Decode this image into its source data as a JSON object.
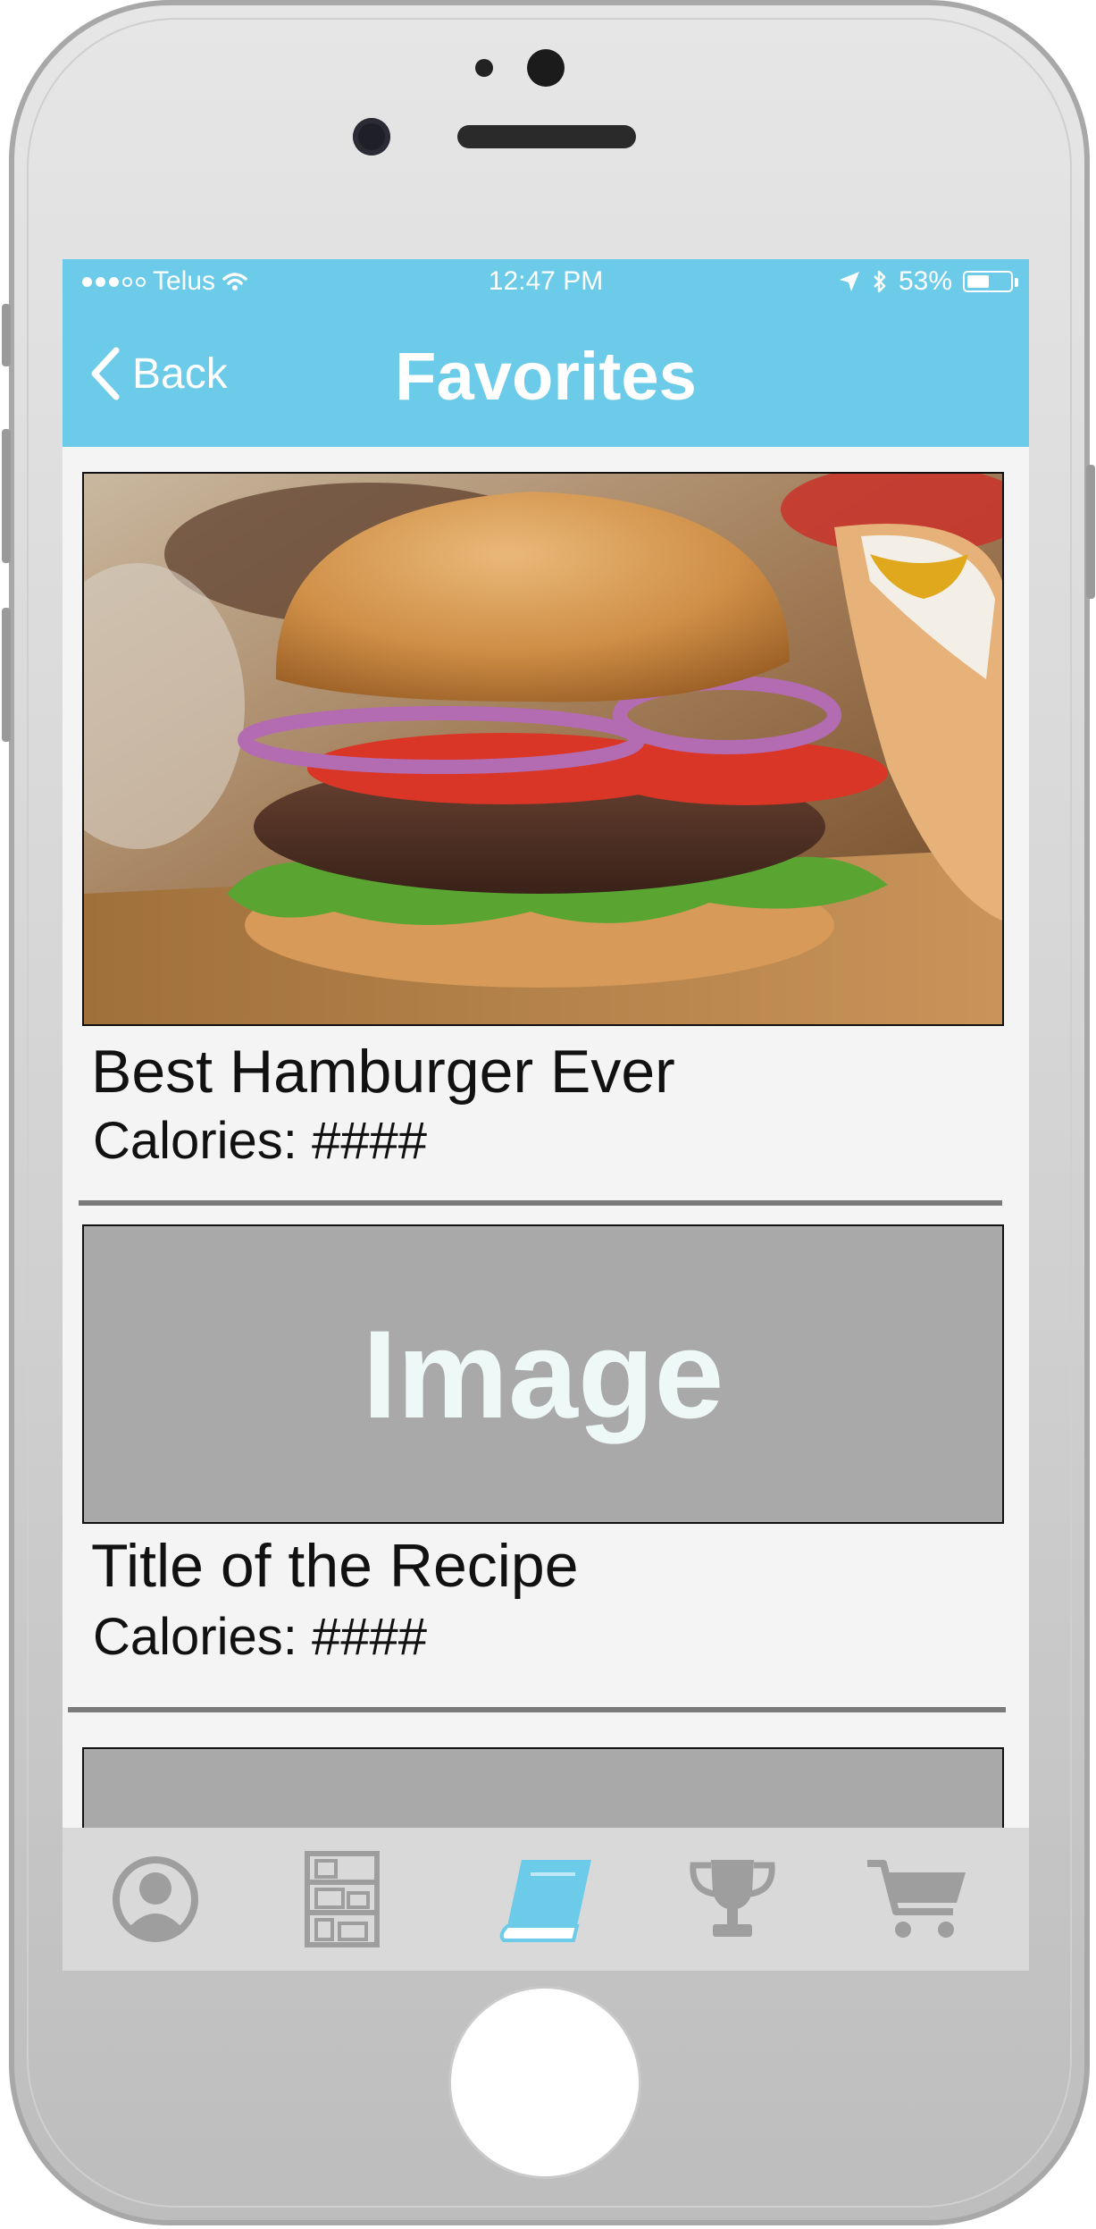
{
  "status_bar": {
    "carrier": "Telus",
    "time": "12:47 PM",
    "battery": "53%",
    "battery_level": 0.53
  },
  "nav": {
    "back_label": "Back",
    "title": "Favorites"
  },
  "recipes": [
    {
      "title": "Best Hamburger Ever",
      "calories": "Calories: ####",
      "image": "hamburger-photo"
    },
    {
      "title": "Title of the Recipe",
      "calories": "Calories: ####",
      "image_placeholder": "Image"
    }
  ],
  "tabs": [
    {
      "icon": "profile-icon",
      "active": false
    },
    {
      "icon": "shelves-icon",
      "active": false
    },
    {
      "icon": "recipe-book-icon",
      "active": true
    },
    {
      "icon": "trophy-icon",
      "active": false
    },
    {
      "icon": "shopping-cart-icon",
      "active": false
    }
  ],
  "colors": {
    "accent": "#6ccbe8",
    "tab_inactive": "#9e9e9e",
    "background": "#f4f4f4",
    "placeholder": "#a9a9a9"
  }
}
